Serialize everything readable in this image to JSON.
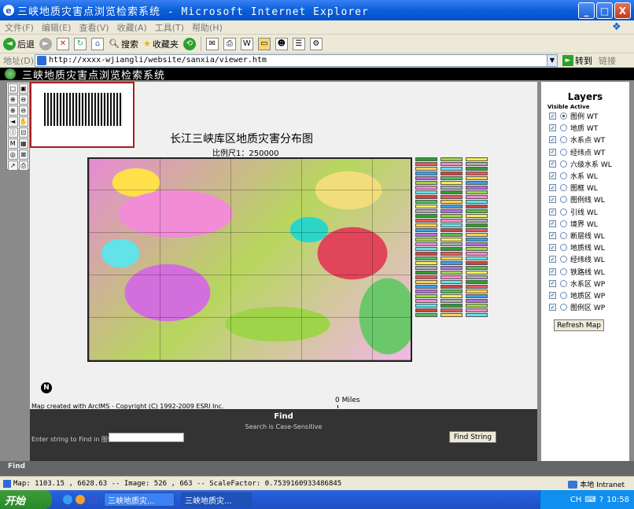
{
  "window": {
    "title": "三峡地质灾害点浏览检索系统 - Microsoft Internet Explorer",
    "minimize": "_",
    "maximize": "□",
    "close": "X"
  },
  "menu": [
    "文件(F)",
    "编辑(E)",
    "查看(V)",
    "收藏(A)",
    "工具(T)",
    "帮助(H)"
  ],
  "toolbar": {
    "back": "后退",
    "search": "搜索",
    "favorites": "收藏夹"
  },
  "address": {
    "label": "地址(D)",
    "url": "http://xxxx-wjiangli/website/sanxia/viewer.htm",
    "go": "转到",
    "links": "链接"
  },
  "banner": {
    "title": "三峡地质灾害点浏览检索系统"
  },
  "map": {
    "title": "长江三峡库区地质灾害分布图",
    "scale": "比例尺1：250000",
    "north": "N",
    "scalebar": "0 Miles",
    "credits": "Map created with ArcIMS - Copyright (C) 1992-2009 ESRI Inc."
  },
  "tools": [
    "□",
    "▣",
    "⊕",
    "⊖",
    "⊕",
    "⊖",
    "◄",
    "✋",
    "ⓘ",
    "⊡",
    "M",
    "▦",
    "◎",
    "⊠",
    "↗",
    "⎙"
  ],
  "find": {
    "title": "Find",
    "note": "Search is Case-Sensitive",
    "label": "Enter string to Find in 图例 WT:",
    "button": "Find String"
  },
  "layers": {
    "title": "Layers",
    "subheader": "Visible Active",
    "items": [
      {
        "label": "图例 WT",
        "active": true
      },
      {
        "label": "地质 WT",
        "active": false
      },
      {
        "label": "水系点 WT",
        "active": false
      },
      {
        "label": "经纬点 WT",
        "active": false
      },
      {
        "label": "六级水系 WL",
        "active": false
      },
      {
        "label": "水系 WL",
        "active": false
      },
      {
        "label": "图框 WL",
        "active": false
      },
      {
        "label": "图例线 WL",
        "active": false
      },
      {
        "label": "引线 WL",
        "active": false
      },
      {
        "label": "境界 WL",
        "active": false
      },
      {
        "label": "断层线 WL",
        "active": false
      },
      {
        "label": "地质线 WL",
        "active": false
      },
      {
        "label": "经纬线 WL",
        "active": false
      },
      {
        "label": "铁路线 WL",
        "active": false
      },
      {
        "label": "水系区 WP",
        "active": false
      },
      {
        "label": "地质区 WP",
        "active": false
      },
      {
        "label": "图例区 WP",
        "active": false
      }
    ],
    "refresh": "Refresh Map"
  },
  "findbar": {
    "label": "Find"
  },
  "status": {
    "text": "Map: 1103.15 , 6628.63 -- Image: 526 , 663 -- ScaleFactor: 0.7539160933486845",
    "zone": "本地 Intranet"
  },
  "taskbar": {
    "start": "开始",
    "tasks": [
      "三峡地质灾...",
      "三峡地质灾..."
    ],
    "clock": "10:58",
    "tray_lang": "CH"
  },
  "legend_colors": [
    "#2f9e2f",
    "#e35a5a",
    "#ffd24a",
    "#3aa0e6",
    "#b46ed8",
    "#9fd44a",
    "#f08cc7",
    "#61e0e8",
    "#c44",
    "#5b5",
    "#ee5",
    "#aaa"
  ]
}
